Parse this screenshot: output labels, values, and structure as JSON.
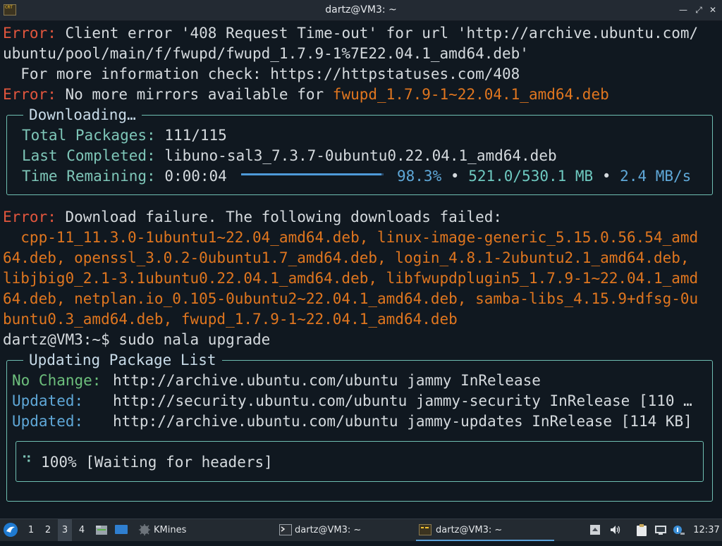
{
  "window": {
    "title": "dartz@VM3: ~",
    "app_icon_text": "CRT"
  },
  "terminal": {
    "lines": [
      {
        "prefix": "Error:",
        "text": " Client error '408 Request Time-out' for url 'http://archive.ubuntu.com/"
      },
      {
        "text": "ubuntu/pool/main/f/fwupd/fwupd_1.7.9-1%7E22.04.1_amd64.deb'"
      },
      {
        "text": "  For more information check: https://httpstatuses.com/408"
      },
      {
        "prefix": "Error:",
        "text": " No more mirrors available for ",
        "highlight": "fwupd_1.7.9-1~22.04.1_amd64.deb"
      }
    ],
    "downloading": {
      "title": "Downloading…",
      "total_label": "Total Packages:",
      "total_value": "111/115",
      "last_label": "Last Completed:",
      "last_value": "libuno-sal3_7.3.7-0ubuntu0.22.04.1_amd64.deb",
      "remaining_label": "Time Remaining:",
      "remaining_value": "0:00:04",
      "percent": "98.3%",
      "progress_fraction": 0.983,
      "sep1": "•",
      "size": "521.0/530.1 MB",
      "sep2": "•",
      "speed": "2.4 MB/s"
    },
    "failure": {
      "prefix": "Error:",
      "text": " Download failure. The following downloads failed:",
      "list_lines": [
        "  cpp-11_11.3.0-1ubuntu1~22.04_amd64.deb, linux-image-generic_5.15.0.56.54_amd",
        "64.deb, openssl_3.0.2-0ubuntu1.7_amd64.deb, login_4.8.1-2ubuntu2.1_amd64.deb,",
        "libjbig0_2.1-3.1ubuntu0.22.04.1_amd64.deb, libfwupdplugin5_1.7.9-1~22.04.1_amd",
        "64.deb, netplan.io_0.105-0ubuntu2~22.04.1_amd64.deb, samba-libs_4.15.9+dfsg-0u",
        "buntu0.3_amd64.deb, fwupd_1.7.9-1~22.04.1_amd64.deb"
      ]
    },
    "prompt": {
      "text": "dartz@VM3:~$ ",
      "command": "sudo nala upgrade"
    },
    "updating": {
      "title": "Updating Package List",
      "rows": [
        {
          "status": "No Change:",
          "kind": "nochange",
          "value": "http://archive.ubuntu.com/ubuntu jammy InRelease"
        },
        {
          "status": "Updated:",
          "kind": "updated",
          "value": "http://security.ubuntu.com/ubuntu jammy-security InRelease [110 …"
        },
        {
          "status": "Updated:",
          "kind": "updated",
          "value": "http://archive.ubuntu.com/ubuntu jammy-updates InRelease [114 KB]"
        }
      ],
      "spinner": "⠙",
      "status_text": "100% [Waiting for headers]"
    }
  },
  "taskbar": {
    "workspaces": [
      "1",
      "2",
      "3",
      "4"
    ],
    "active_workspace": "3",
    "tasks": [
      {
        "label": "KMines",
        "icon": "kmines-icon"
      },
      {
        "label": "dartz@VM3: ~",
        "icon": "terminal-icon"
      },
      {
        "label": "dartz@VM3: ~",
        "icon": "cool-retro-term-icon",
        "active": true
      }
    ],
    "clock": "12:37"
  },
  "colors": {
    "error": "#e2563d",
    "package": "#e0761f",
    "box_border": "#6fbfb2",
    "progress": "#4e9ad8",
    "background": "#101820"
  }
}
